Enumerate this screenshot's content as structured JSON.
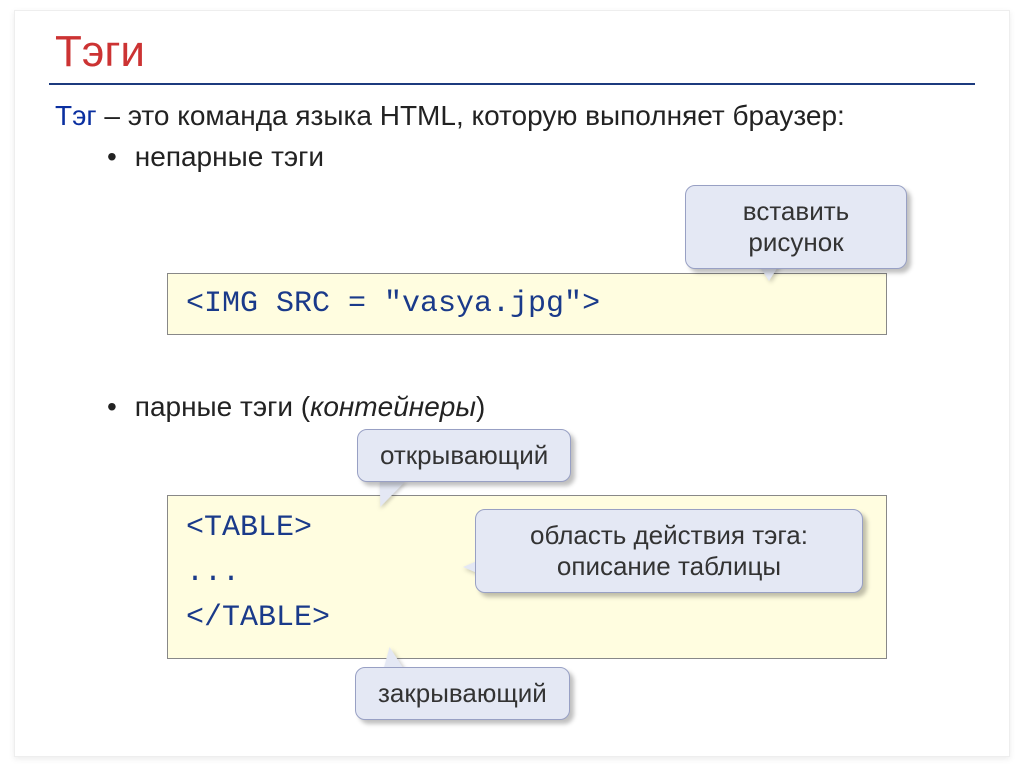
{
  "title": "Тэги",
  "lead": "Тэг",
  "definition": "– это команда языка HTML, которую выполняет браузер:",
  "bullets": {
    "unpaired": "непарные тэги",
    "paired_prefix": "парные тэги (",
    "paired_italic": "контейнеры",
    "paired_suffix": ")"
  },
  "code": {
    "img": "<IMG SRC = \"vasya.jpg\">",
    "table_open": "<TABLE>",
    "table_dots": "...",
    "table_close": "</TABLE>"
  },
  "notes": {
    "insert": "вставить рисунок",
    "open": "открывающий",
    "scope": "область действия тэга: описание таблицы",
    "close": "закрывающий"
  }
}
